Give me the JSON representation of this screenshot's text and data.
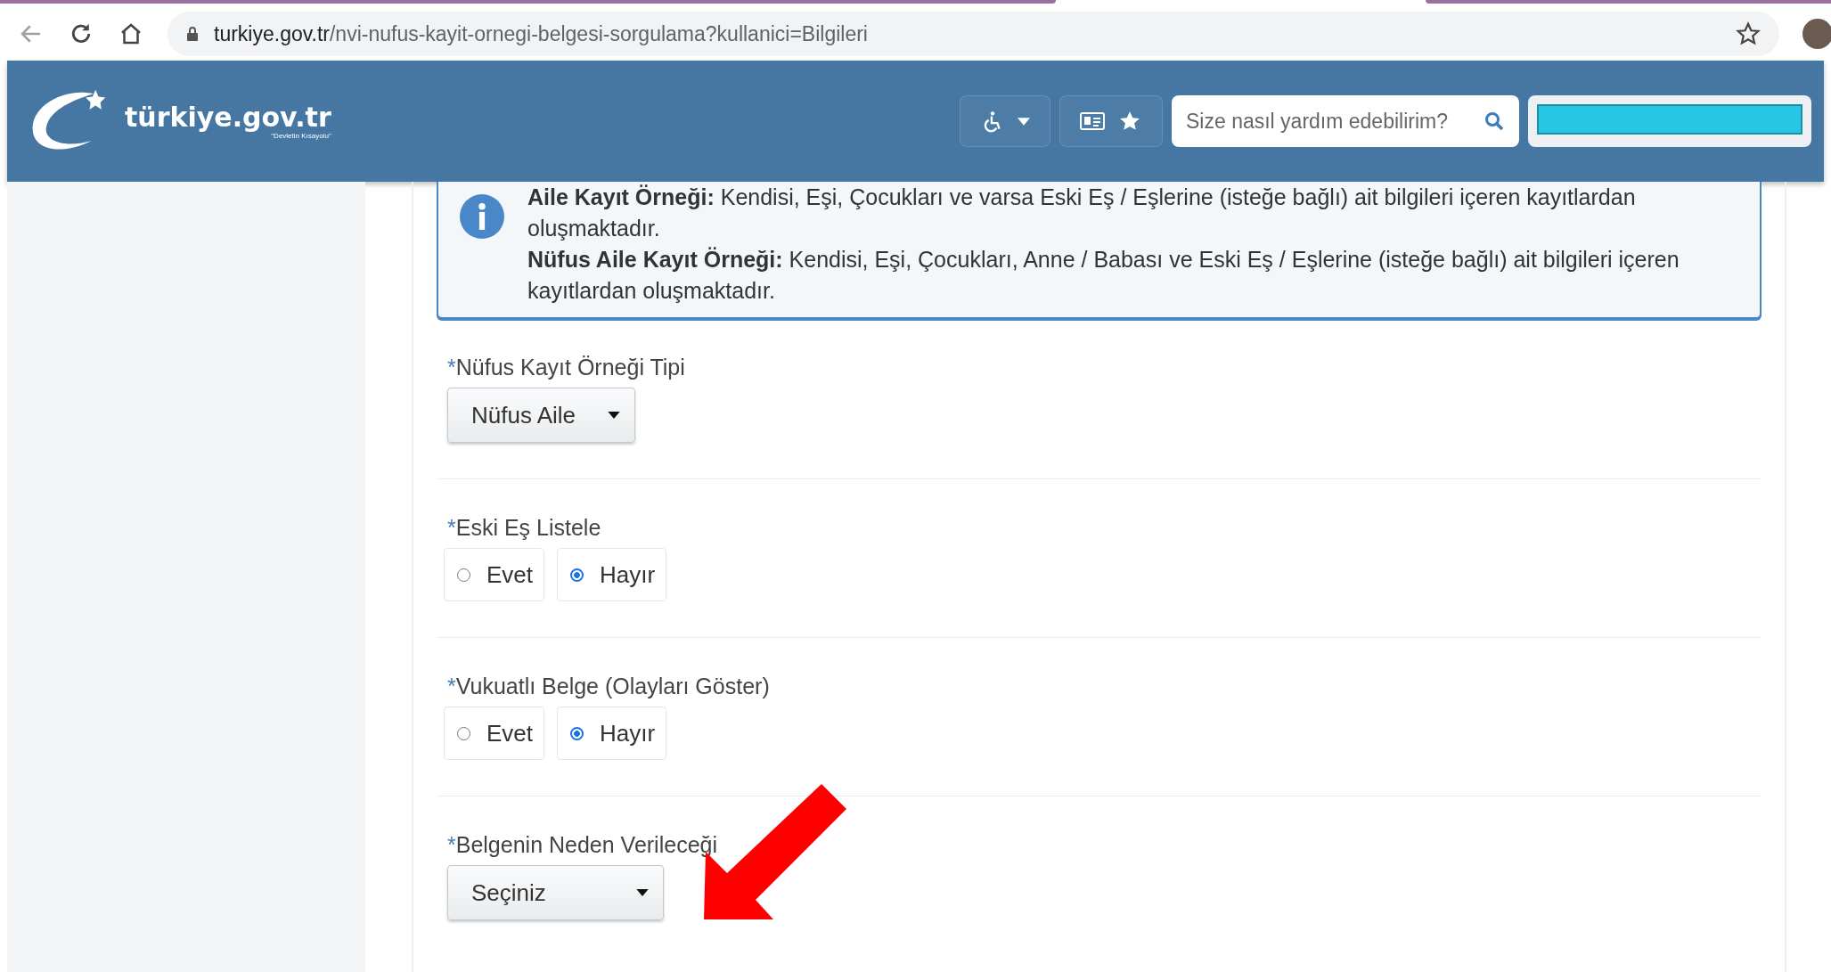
{
  "browser": {
    "url": {
      "host": "turkiye.gov.tr",
      "path": "/nvi-nufus-kayit-ornegi-belgesi-sorgulama?kullanici=Bilgileri"
    }
  },
  "header": {
    "logo": {
      "name": "türkiye.gov.tr",
      "tagline": "\"Devletin Kısayolu\""
    },
    "search": {
      "placeholder": "Size nasıl yardım edebilirim?"
    }
  },
  "info": {
    "paragraphs": [
      "**Aile Kayıt Örneği:** Kendisi, Eşi, Çocukları ve varsa Eski Eş / Eşlerine (isteğe bağlı) ait bilgileri içeren kayıtlardan oluşmaktadır.",
      "**Nüfus Aile Kayıt Örneği:** Kendisi, Eşi, Çocukları, Anne / Babası ve Eski Eş / Eşlerine (isteğe bağlı) ait bilgileri içeren kayıtlardan oluşmaktadır."
    ]
  },
  "form": {
    "fields": [
      {
        "kind": "select",
        "marker": "*",
        "label": "Nüfus Kayıt Örneği Tipi",
        "value": "Nüfus Aile"
      },
      {
        "kind": "radio",
        "marker": "*",
        "label": "Eski Eş Listele",
        "options": [
          {
            "label": "Evet",
            "selected": false
          },
          {
            "label": "Hayır",
            "selected": true
          }
        ]
      },
      {
        "kind": "radio",
        "marker": "*",
        "label": "Vukuatlı Belge (Olayları Göster)",
        "options": [
          {
            "label": "Evet",
            "selected": false
          },
          {
            "label": "Hayır",
            "selected": true
          }
        ]
      },
      {
        "kind": "select",
        "marker": "*",
        "label": "Belgenin Neden Verileceği",
        "value": "Seçiniz"
      }
    ]
  }
}
